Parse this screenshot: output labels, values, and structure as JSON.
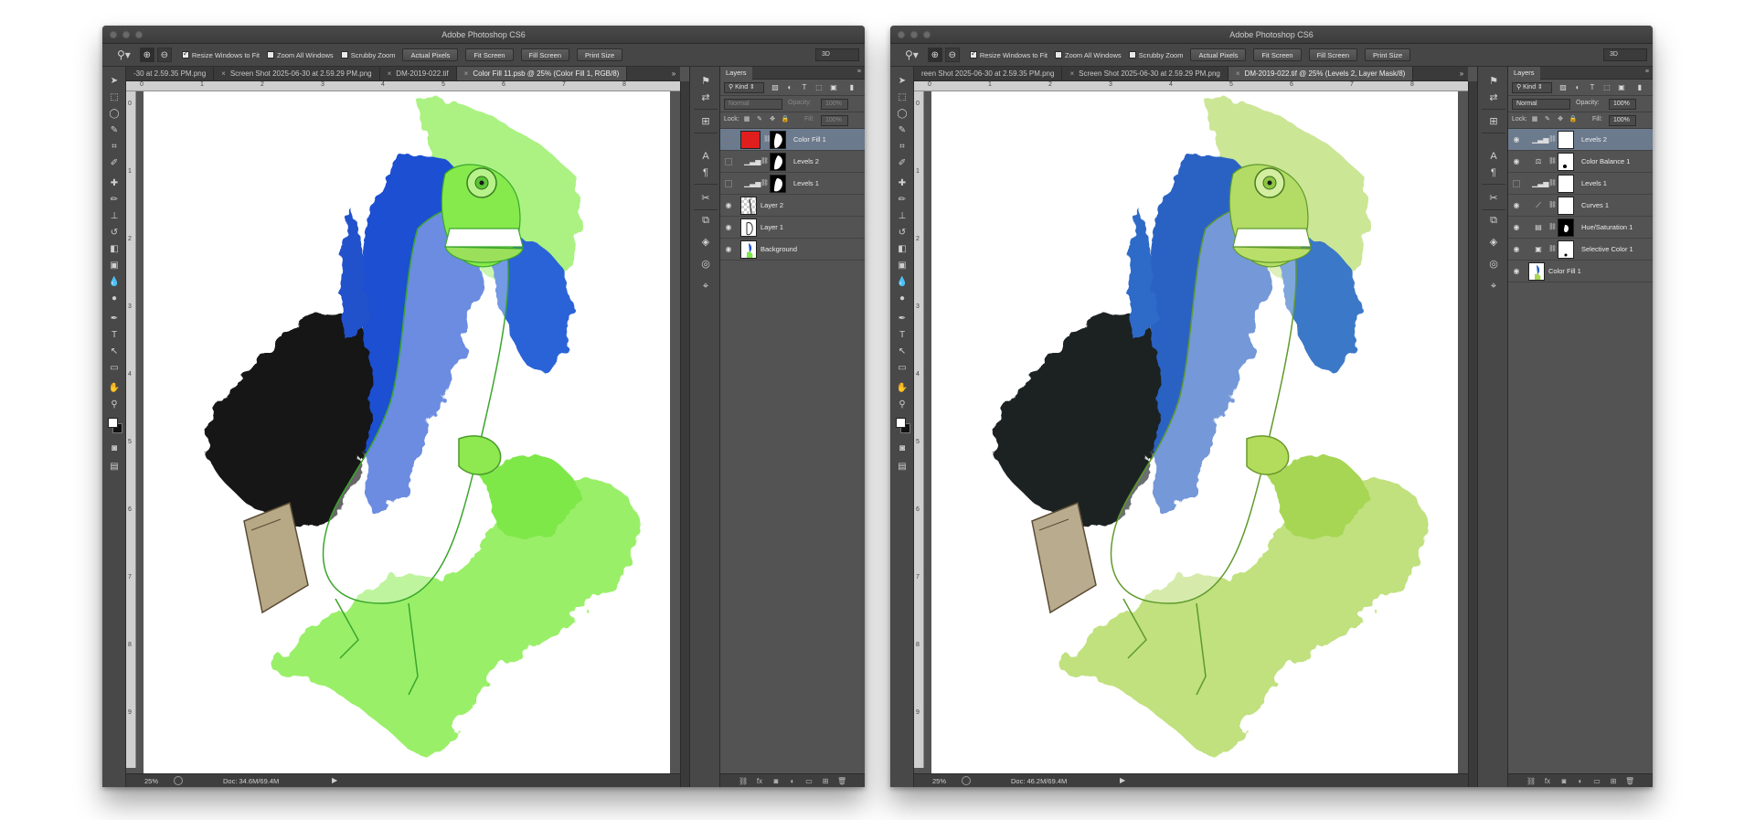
{
  "left_window": {
    "title": "Adobe Photoshop CS6",
    "options": {
      "resize_windows": "Resize Windows to Fit",
      "zoom_all": "Zoom All Windows",
      "scrubby": "Scrubby Zoom",
      "actual_pixels": "Actual Pixels",
      "fit_screen": "Fit Screen",
      "fill_screen": "Fill Screen",
      "print_size": "Print Size",
      "workspace": "3D"
    },
    "tabs": [
      "-30 at 2.59.35 PM.png",
      "Screen Shot 2025-06-30 at 2.59.29 PM.png",
      "DM-2019-022.tif",
      "Color Fill 11.psb @ 25% (Color Fill 1, RGB/8)"
    ],
    "ruler": {
      "top": [
        "0",
        "1",
        "2",
        "3",
        "4",
        "5",
        "6",
        "7",
        "8"
      ],
      "left": [
        "0",
        "1",
        "2",
        "3",
        "4",
        "5",
        "6",
        "7",
        "8",
        "9"
      ]
    },
    "status": {
      "zoom": "25%",
      "doc": "Doc: 34.6M/69.4M"
    },
    "panel": {
      "tab": "Layers",
      "kind": "Kind",
      "blend": "Normal",
      "opacity_label": "Opacity:",
      "opacity_value": "100%",
      "lock_label": "Lock:",
      "fill_label": "Fill:",
      "fill_value": "100%",
      "layers": [
        {
          "name": "Color Fill 1",
          "visible": false,
          "selected": true
        },
        {
          "name": "Levels 2",
          "visible": false,
          "selected": false
        },
        {
          "name": "Levels 1",
          "visible": false,
          "selected": false
        },
        {
          "name": "Layer 2",
          "visible": true,
          "selected": false
        },
        {
          "name": "Layer 1",
          "visible": true,
          "selected": false
        },
        {
          "name": "Background",
          "visible": true,
          "selected": false
        }
      ]
    },
    "colors": {
      "fill_swatch": "#e01e1e",
      "body_green": "#7ee84a",
      "hair_blue": "#1f4fd1"
    }
  },
  "right_window": {
    "title": "Adobe Photoshop CS6",
    "options": {
      "resize_windows": "Resize Windows to Fit",
      "zoom_all": "Zoom All Windows",
      "scrubby": "Scrubby Zoom",
      "actual_pixels": "Actual Pixels",
      "fit_screen": "Fit Screen",
      "fill_screen": "Fill Screen",
      "print_size": "Print Size",
      "workspace": "3D"
    },
    "tabs": [
      "reen Shot 2025-06-30 at 2.59.35 PM.png",
      "Screen Shot 2025-06-30 at 2.59.29 PM.png",
      "DM-2019-022.tif @ 25% (Levels 2, Layer Mask/8)"
    ],
    "ruler": {
      "top": [
        "0",
        "1",
        "2",
        "3",
        "4",
        "5",
        "6",
        "7",
        "8"
      ],
      "left": [
        "0",
        "1",
        "2",
        "3",
        "4",
        "5",
        "6",
        "7",
        "8",
        "9"
      ]
    },
    "status": {
      "zoom": "25%",
      "doc": "Doc: 46.2M/69.4M"
    },
    "panel": {
      "tab": "Layers",
      "kind": "Kind",
      "blend": "Normal",
      "opacity_label": "Opacity:",
      "opacity_value": "100%",
      "lock_label": "Lock:",
      "fill_label": "Fill:",
      "fill_value": "100%",
      "layers": [
        {
          "name": "Levels 2",
          "visible": true,
          "selected": true
        },
        {
          "name": "Color Balance 1",
          "visible": true,
          "selected": false
        },
        {
          "name": "Levels 1",
          "visible": false,
          "selected": false
        },
        {
          "name": "Curves 1",
          "visible": true,
          "selected": false
        },
        {
          "name": "Hue/Saturation 1",
          "visible": true,
          "selected": false
        },
        {
          "name": "Selective Color 1",
          "visible": true,
          "selected": false
        },
        {
          "name": "Color Fill 1",
          "visible": true,
          "selected": false
        }
      ]
    },
    "colors": {
      "body_green": "#a6d653",
      "hair_blue": "#2a62c4"
    }
  }
}
